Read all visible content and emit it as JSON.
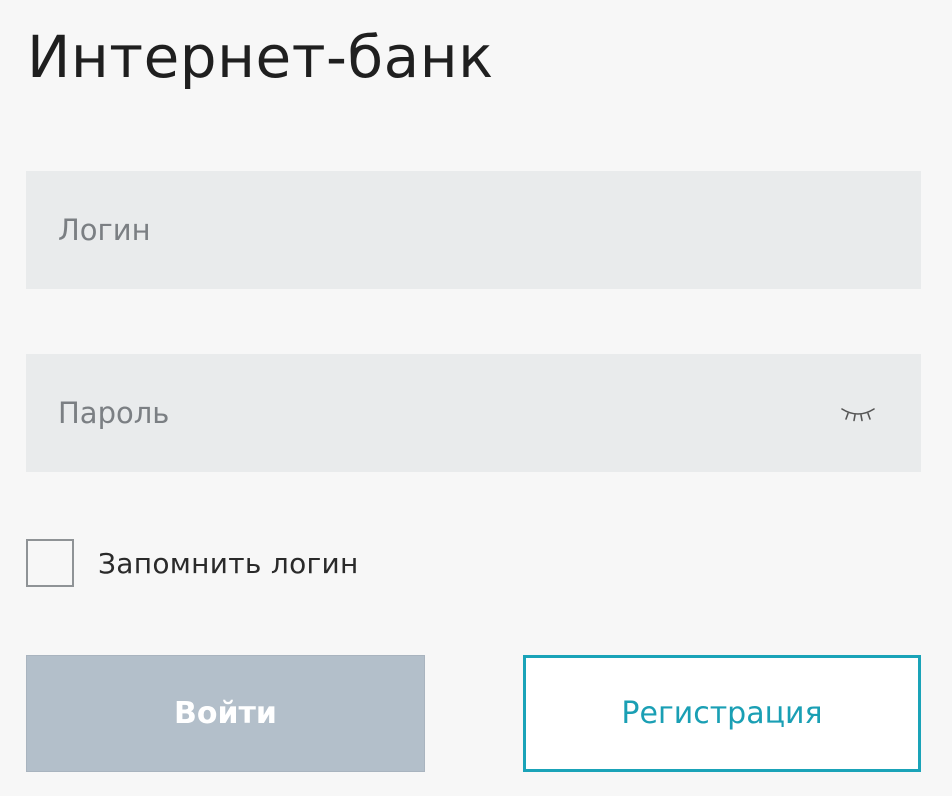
{
  "header": {
    "title": "Интернет-банк"
  },
  "form": {
    "login_placeholder": "Логин",
    "login_value": "",
    "password_placeholder": "Пароль",
    "password_value": "",
    "password_toggle_icon": "eye-closed-icon",
    "remember_label": "Запомнить логин",
    "remember_checked": false
  },
  "buttons": {
    "login_label": "Войти",
    "register_label": "Регистрация"
  },
  "colors": {
    "background": "#f7f7f7",
    "field_background": "#e9ebec",
    "login_button_disabled": "#b3bfca",
    "accent": "#1aa3b8"
  }
}
